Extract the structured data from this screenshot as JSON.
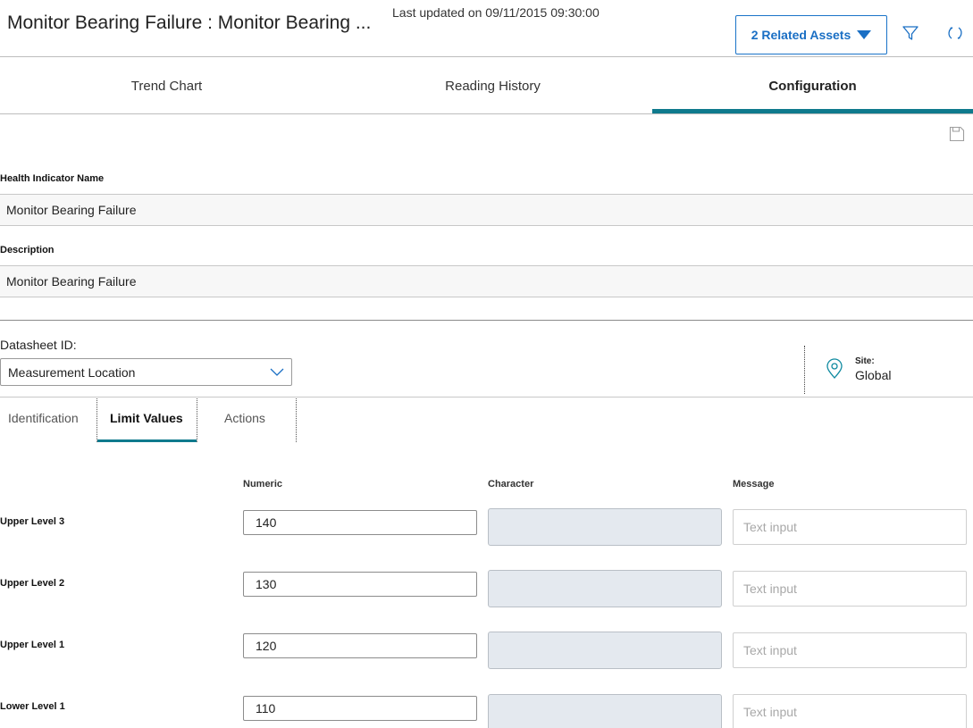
{
  "header": {
    "title": "Monitor Bearing Failure : Monitor Bearing ...",
    "last_updated": "Last updated on 09/11/2015 09:30:00",
    "related_assets_label": "2 Related Assets",
    "icons": [
      "filter-icon",
      "refresh-icon",
      "caret-down-icon"
    ]
  },
  "tabs": [
    {
      "label": "Trend Chart",
      "active": false
    },
    {
      "label": "Reading History",
      "active": false
    },
    {
      "label": "Configuration",
      "active": true
    }
  ],
  "toolbar": {
    "save_icon": "save-icon"
  },
  "fields": {
    "health_indicator_name": {
      "label": "Health Indicator Name",
      "value": "Monitor Bearing Failure"
    },
    "description": {
      "label": "Description",
      "value": "Monitor Bearing Failure"
    }
  },
  "datasheet": {
    "label": "Datasheet ID:",
    "selected": "Measurement Location"
  },
  "site": {
    "label": "Site:",
    "value": "Global",
    "icon": "location-pin-icon"
  },
  "subtabs": [
    {
      "label": "Identification",
      "active": false
    },
    {
      "label": "Limit Values",
      "active": true
    },
    {
      "label": "Actions",
      "active": false
    }
  ],
  "limits": {
    "columns": {
      "numeric": "Numeric",
      "character": "Character",
      "message": "Message"
    },
    "rows": [
      {
        "label": "Upper Level 3",
        "numeric": "140",
        "character": "",
        "message_placeholder": "Text input"
      },
      {
        "label": "Upper Level 2",
        "numeric": "130",
        "character": "",
        "message_placeholder": "Text input"
      },
      {
        "label": "Upper Level 1",
        "numeric": "120",
        "character": "",
        "message_placeholder": "Text input"
      },
      {
        "label": "Lower Level 1",
        "numeric": "110",
        "character": "",
        "message_placeholder": "Text input"
      }
    ]
  },
  "colors": {
    "accent_teal": "#0f7a8d",
    "link_blue": "#1a6fc4",
    "disabled_field": "#e4e9ef"
  }
}
